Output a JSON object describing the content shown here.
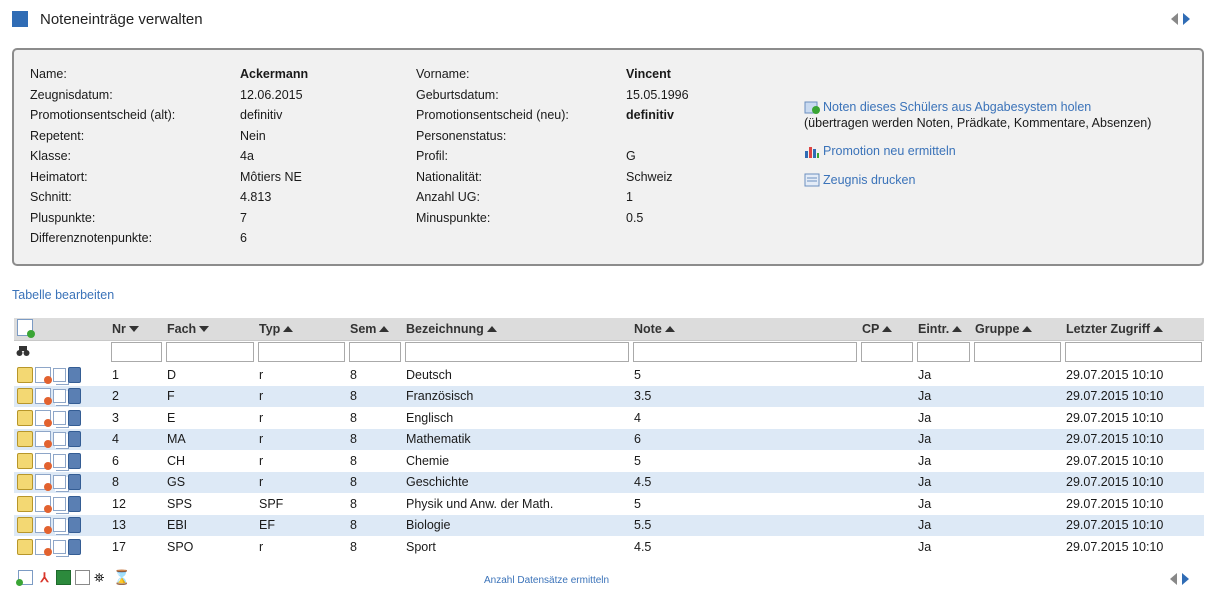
{
  "header": {
    "title": "Noteneinträge verwalten"
  },
  "student": {
    "left": [
      {
        "label": "Name:",
        "value": "Ackermann",
        "bold": true
      },
      {
        "label": "Zeugnisdatum:",
        "value": "12.06.2015"
      },
      {
        "label": "Promotionsentscheid (alt):",
        "value": "definitiv"
      },
      {
        "label": "Repetent:",
        "value": "Nein"
      },
      {
        "label": "Klasse:",
        "value": "4a"
      },
      {
        "label": "Heimatort:",
        "value": "Môtiers NE"
      },
      {
        "label": "Schnitt:",
        "value": "4.813"
      },
      {
        "label": "Pluspunkte:",
        "value": "7"
      },
      {
        "label": "Differenznotenpunkte:",
        "value": "6"
      }
    ],
    "right": [
      {
        "label": "Vorname:",
        "value": "Vincent",
        "bold": true
      },
      {
        "label": "Geburtsdatum:",
        "value": "15.05.1996"
      },
      {
        "label": "Promotionsentscheid (neu):",
        "value": "definitiv",
        "bold": true
      },
      {
        "label": "Personenstatus:",
        "value": ""
      },
      {
        "label": "Profil:",
        "value": "G"
      },
      {
        "label": "Nationalität:",
        "value": "Schweiz"
      },
      {
        "label": "Anzahl UG:",
        "value": "1"
      },
      {
        "label": "Minuspunkte:",
        "value": "0.5"
      }
    ]
  },
  "actions": {
    "fetch_label": "Noten dieses Schülers aus Abgabesystem holen",
    "fetch_sub": "(übertragen werden Noten, Prädkate, Kommentare, Absenzen)",
    "promotion_label": "Promotion neu ermitteln",
    "print_label": "Zeugnis drucken"
  },
  "table_edit_label": "Tabelle bearbeiten",
  "table": {
    "columns": [
      "Nr",
      "Fach",
      "Typ",
      "Sem",
      "Bezeichnung",
      "Note",
      "CP",
      "Eintr.",
      "Gruppe",
      "Letzter Zugriff"
    ],
    "rows": [
      [
        "1",
        "D",
        "r",
        "8",
        "Deutsch",
        "5",
        "",
        "Ja",
        "",
        "29.07.2015 10:10"
      ],
      [
        "2",
        "F",
        "r",
        "8",
        "Französisch",
        "3.5",
        "",
        "Ja",
        "",
        "29.07.2015 10:10"
      ],
      [
        "3",
        "E",
        "r",
        "8",
        "Englisch",
        "4",
        "",
        "Ja",
        "",
        "29.07.2015 10:10"
      ],
      [
        "4",
        "MA",
        "r",
        "8",
        "Mathematik",
        "6",
        "",
        "Ja",
        "",
        "29.07.2015 10:10"
      ],
      [
        "6",
        "CH",
        "r",
        "8",
        "Chemie",
        "5",
        "",
        "Ja",
        "",
        "29.07.2015 10:10"
      ],
      [
        "8",
        "GS",
        "r",
        "8",
        "Geschichte",
        "4.5",
        "",
        "Ja",
        "",
        "29.07.2015 10:10"
      ],
      [
        "12",
        "SPS",
        "SPF",
        "8",
        "Physik und Anw. der Math.",
        "5",
        "",
        "Ja",
        "",
        "29.07.2015 10:10"
      ],
      [
        "13",
        "EBI",
        "EF",
        "8",
        "Biologie",
        "5.5",
        "",
        "Ja",
        "",
        "29.07.2015 10:10"
      ],
      [
        "17",
        "SPO",
        "r",
        "8",
        "Sport",
        "4.5",
        "",
        "Ja",
        "",
        "29.07.2015 10:10"
      ]
    ]
  },
  "footer": {
    "count_link": "Anzahl Datensätze ermitteln"
  },
  "colors": {
    "accent": "#2f6cb5",
    "link": "#3b73b9",
    "row_alt": "#dde9f6",
    "header_bg": "#dcdcdc"
  }
}
